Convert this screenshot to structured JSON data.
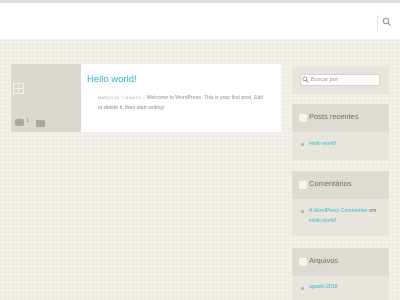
{
  "header": {
    "search_icon": "search-icon"
  },
  "post": {
    "title": "Hello world!",
    "date": "MARÇO 26, 7 MINUTO",
    "excerpt": "Welcome to WordPress. This is your first post. Edit or delete it, then start writing!",
    "comment_count": "1",
    "icons": [
      "plus-icon",
      "comment-icon",
      "folder-icon"
    ]
  },
  "sidebar": {
    "search": {
      "placeholder": "Buscar por:"
    },
    "recent_posts": {
      "title": "Posts recentes",
      "items": [
        "Hello world!"
      ]
    },
    "comments": {
      "title": "Comentários",
      "author": "A WordPress Commenter",
      "connector": "em",
      "post": "Hello world!"
    },
    "archives": {
      "title": "Arquivos",
      "items": [
        "agosto 2018"
      ]
    }
  },
  "colors": {
    "accent": "#31b6c6",
    "background": "#f3f1ea",
    "widget_background": "#e8e6dc",
    "widget_header": "#dedcd2",
    "thumbnail": "#dbd9cf"
  }
}
